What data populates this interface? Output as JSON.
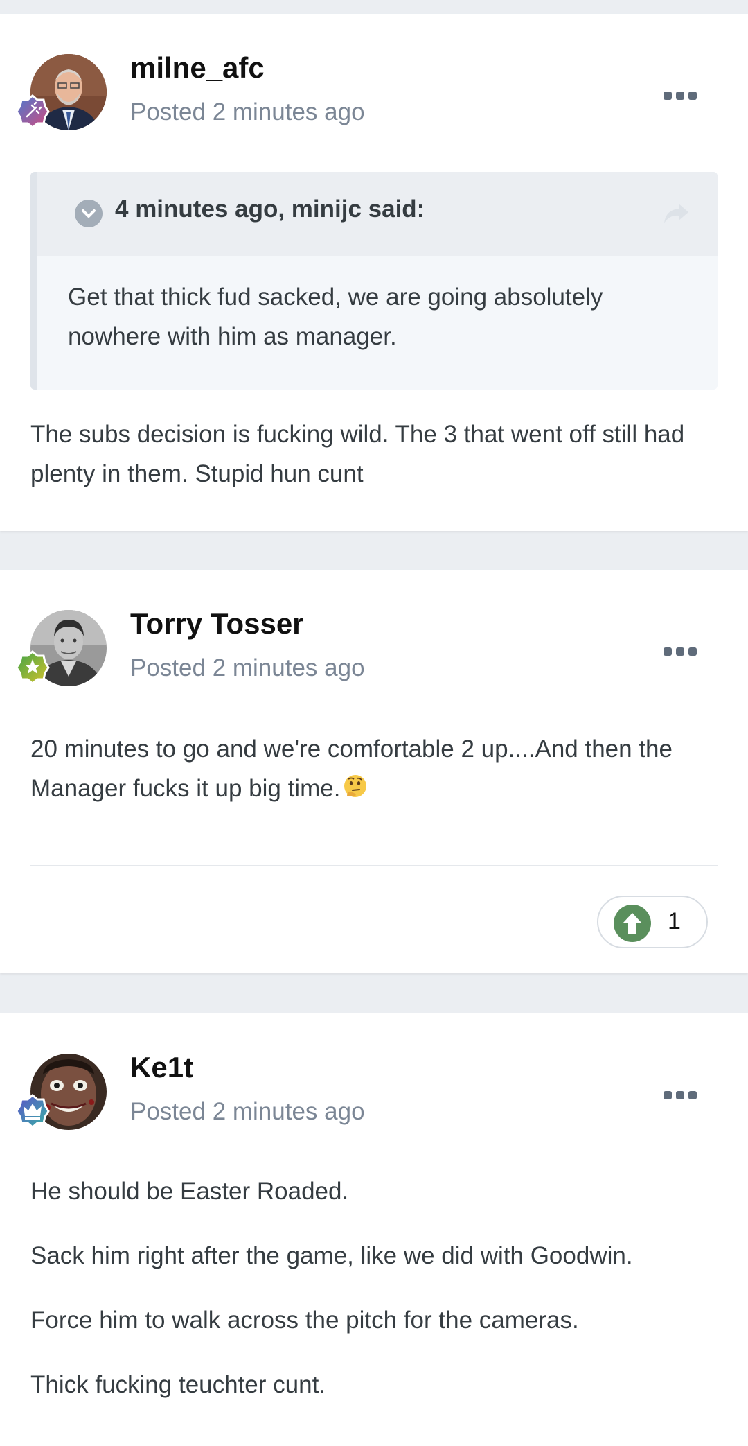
{
  "posts": [
    {
      "author": "milne_afc",
      "posted": "Posted 2 minutes ago",
      "rank_icon": "rank-badge-icon",
      "quote": {
        "cite": "4 minutes ago, minijc said:",
        "body": "Get that thick fud sacked, we are going absolutely nowhere with him as manager."
      },
      "body": "The subs decision is fucking wild. The 3 that went off still had plenty in them. Stupid hun cunt"
    },
    {
      "author": "Torry Tosser",
      "posted": "Posted 2 minutes ago",
      "rank_icon": "rank-badge-icon",
      "body": "20 minutes to go and we're comfortable 2 up....And then the Manager fucks it up big time.",
      "emoji": "thinking-face-emoji",
      "reaction": {
        "icon": "upvote-arrow-icon",
        "count": "1"
      }
    },
    {
      "author": "Ke1t",
      "posted": "Posted 2 minutes ago",
      "rank_icon": "rank-badge-icon",
      "paragraphs": [
        "He should be Easter Roaded.",
        "Sack him right after the game, like we did with Goodwin.",
        "Force him to walk across the pitch for the cameras.",
        "Thick fucking teuchter cunt."
      ]
    }
  ],
  "colors": {
    "page_background": "#ebeef2",
    "card_background": "#ffffff",
    "author_text": "#111111",
    "meta_text": "#7b8695",
    "body_text": "#353c41",
    "quote_background": "#f4f7fa",
    "quote_header": "#ebeef2",
    "reaction_green": "#5a8f5c"
  }
}
